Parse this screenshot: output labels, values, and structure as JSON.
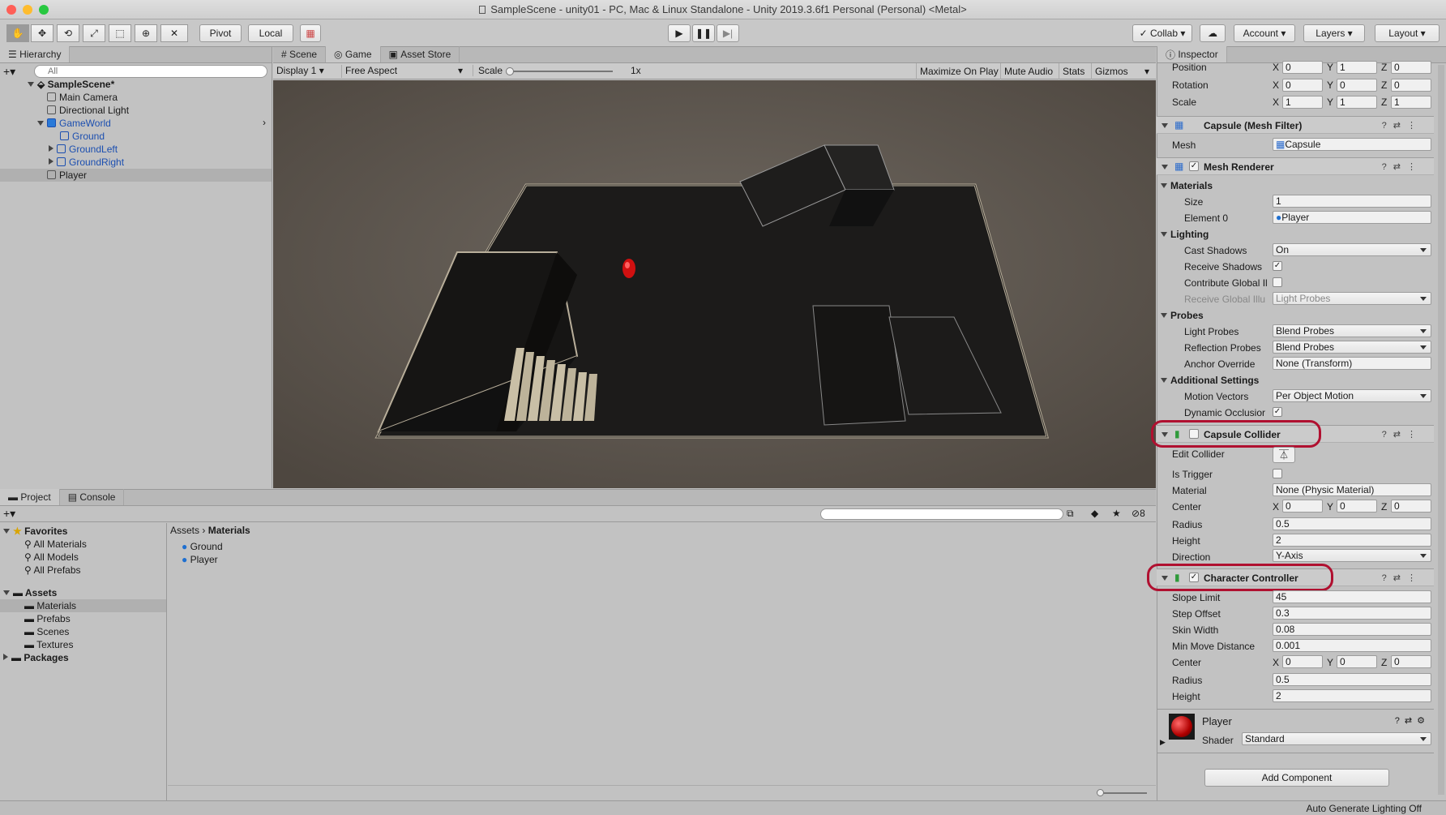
{
  "window": {
    "title": "SampleScene - unity01 - PC, Mac & Linux Standalone - Unity 2019.3.6f1 Personal (Personal) <Metal>"
  },
  "toolbar": {
    "pivot": "Pivot",
    "local": "Local",
    "collab": "Collab",
    "account": "Account",
    "layers": "Layers",
    "layout": "Layout"
  },
  "hierarchy": {
    "tab": "Hierarchy",
    "search_placeholder": "All",
    "scene": "SampleScene*",
    "items": [
      "Main Camera",
      "Directional Light",
      "GameWorld",
      "Ground",
      "GroundLeft",
      "GroundRight",
      "Player"
    ]
  },
  "game": {
    "tabs": [
      "Scene",
      "Game",
      "Asset Store"
    ],
    "display": "Display 1",
    "aspect": "Free Aspect",
    "scale_label": "Scale",
    "scale_value": "1x",
    "buttons": [
      "Maximize On Play",
      "Mute Audio",
      "Stats",
      "Gizmos"
    ]
  },
  "project": {
    "tabs": [
      "Project",
      "Console"
    ],
    "hidden_count": "8",
    "favorites": "Favorites",
    "fav_items": [
      "All Materials",
      "All Models",
      "All Prefabs"
    ],
    "assets": "Assets",
    "asset_folders": [
      "Materials",
      "Prefabs",
      "Scenes",
      "Textures"
    ],
    "packages": "Packages",
    "breadcrumb": [
      "Assets",
      "Materials"
    ],
    "files": [
      "Ground",
      "Player"
    ]
  },
  "inspector": {
    "tab": "Inspector",
    "transform": {
      "position_label": "Position",
      "rotation_label": "Rotation",
      "scale_label": "Scale",
      "position": [
        "0",
        "1",
        "0"
      ],
      "rotation": [
        "0",
        "0",
        "0"
      ],
      "scale": [
        "1",
        "1",
        "1"
      ]
    },
    "mesh_filter": {
      "title": "Capsule (Mesh Filter)",
      "mesh_label": "Mesh",
      "mesh": "Capsule"
    },
    "mesh_renderer": {
      "title": "Mesh Renderer",
      "materials": "Materials",
      "size_label": "Size",
      "size": "1",
      "element0_label": "Element 0",
      "element0": "Player",
      "lighting": "Lighting",
      "cast_shadows_label": "Cast Shadows",
      "cast_shadows": "On",
      "receive_shadows_label": "Receive Shadows",
      "contribute_gi_label": "Contribute Global Il",
      "receive_gi_label": "Receive Global Illu",
      "receive_gi": "Light Probes",
      "probes": "Probes",
      "light_probes_label": "Light Probes",
      "light_probes": "Blend Probes",
      "reflection_probes_label": "Reflection Probes",
      "reflection_probes": "Blend Probes",
      "anchor_label": "Anchor Override",
      "anchor": "None (Transform)",
      "additional": "Additional Settings",
      "motion_vectors_label": "Motion Vectors",
      "motion_vectors": "Per Object Motion",
      "dynamic_occlusion_label": "Dynamic Occlusior"
    },
    "capsule_collider": {
      "title": "Capsule Collider",
      "edit_label": "Edit Collider",
      "trigger_label": "Is Trigger",
      "material_label": "Material",
      "material": "None (Physic Material)",
      "center_label": "Center",
      "center": [
        "0",
        "0",
        "0"
      ],
      "radius_label": "Radius",
      "radius": "0.5",
      "height_label": "Height",
      "height": "2",
      "direction_label": "Direction",
      "direction": "Y-Axis"
    },
    "character_controller": {
      "title": "Character Controller",
      "slope_label": "Slope Limit",
      "slope": "45",
      "step_label": "Step Offset",
      "step": "0.3",
      "skin_label": "Skin Width",
      "skin": "0.08",
      "min_move_label": "Min Move Distance",
      "min_move": "0.001",
      "center_label": "Center",
      "center": [
        "0",
        "0",
        "0"
      ],
      "radius_label": "Radius",
      "radius": "0.5",
      "height_label": "Height",
      "height": "2"
    },
    "material": {
      "name": "Player",
      "shader_label": "Shader",
      "shader": "Standard"
    },
    "add_component": "Add Component"
  },
  "status": {
    "text": "Auto Generate Lighting Off"
  },
  "colors": {
    "highlight": "#b01030",
    "link_blue": "#1c4fb0",
    "player_red": "#d01010"
  }
}
